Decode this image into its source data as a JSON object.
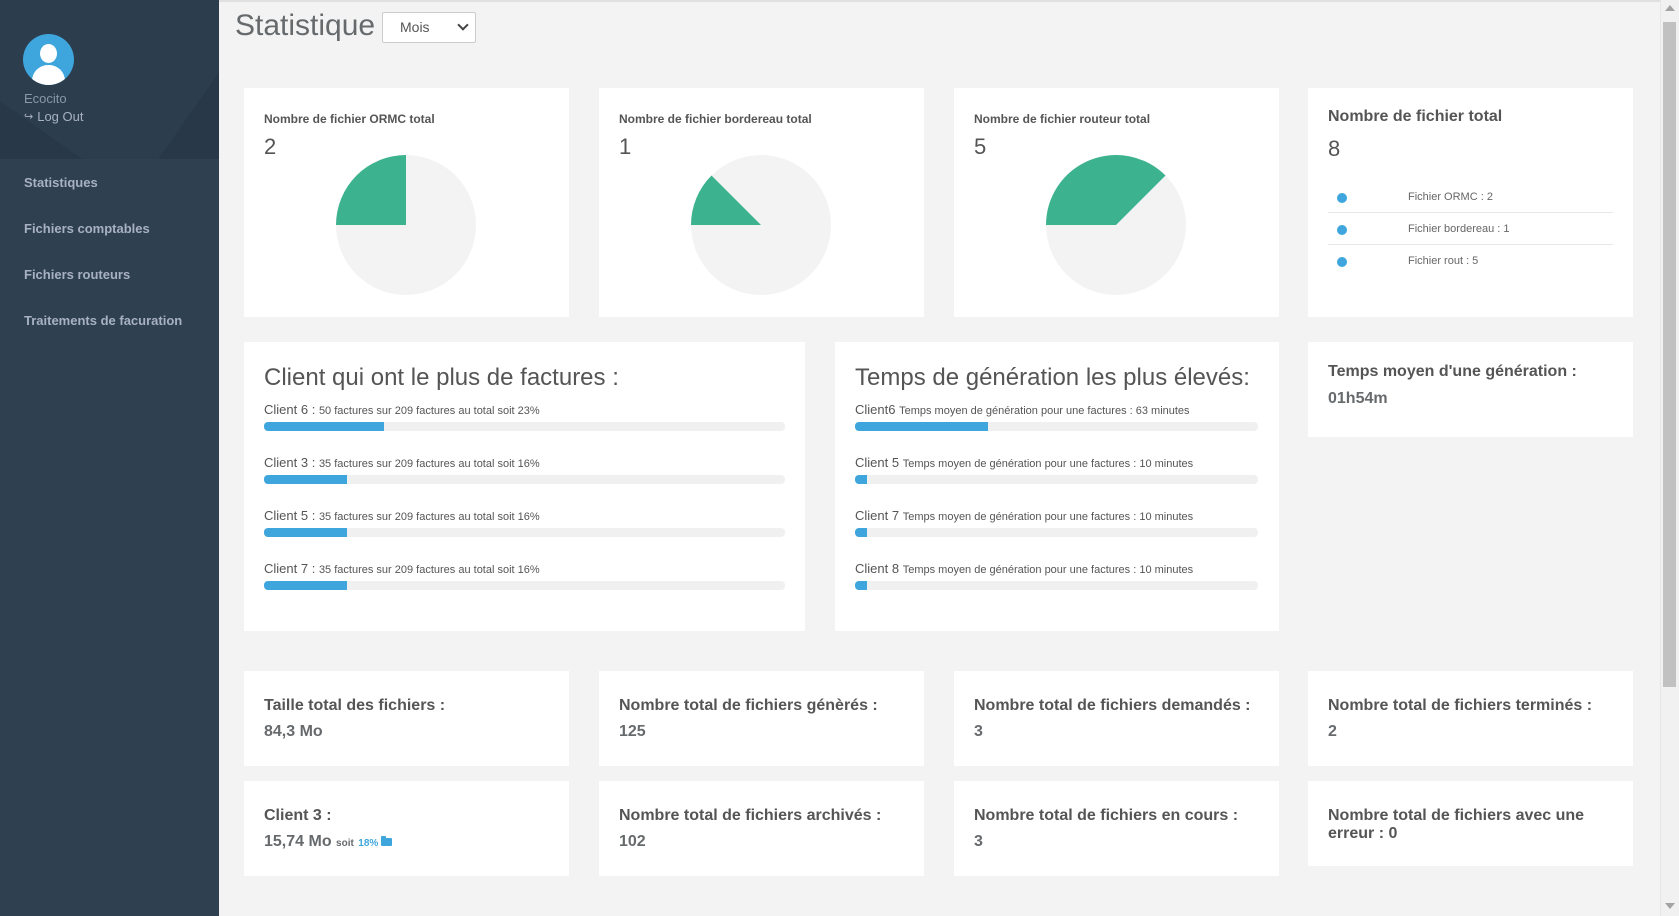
{
  "sidebar": {
    "username": "Ecocito",
    "logout": "Log Out",
    "items": [
      {
        "label": "Statistiques"
      },
      {
        "label": "Fichiers comptables"
      },
      {
        "label": "Fichiers routeurs"
      },
      {
        "label": "Traitements de facuration"
      }
    ]
  },
  "header": {
    "title": "Statistique",
    "period": "Mois"
  },
  "pies": [
    {
      "title": "Nombre de fichier ORMC total",
      "value": "2",
      "fraction": 0.25
    },
    {
      "title": "Nombre de fichier bordereau total",
      "value": "1",
      "fraction": 0.125
    },
    {
      "title": "Nombre de fichier routeur total",
      "value": "5",
      "fraction": 0.375
    }
  ],
  "total": {
    "title": "Nombre de fichier total",
    "value": "8",
    "items": [
      "Fichier ORMC : 2",
      "Fichier bordereau : 1",
      "Fichier rout : 5"
    ]
  },
  "clients": {
    "title": "Client qui ont le plus de factures :",
    "rows": [
      {
        "name": "Client 6 :",
        "desc": "50 factures sur 209 factures au total soit 23%",
        "percent": 23
      },
      {
        "name": "Client 3 :",
        "desc": "35 factures sur 209 factures au total soit 16%",
        "percent": 16
      },
      {
        "name": "Client 5 :",
        "desc": "35 factures sur 209 factures au total soit 16%",
        "percent": 16
      },
      {
        "name": "Client 7 :",
        "desc": "35 factures sur 209 factures au total soit 16%",
        "percent": 16
      }
    ]
  },
  "generation": {
    "title": "Temps de génération les plus élevés:",
    "rows": [
      {
        "name": "Client6",
        "desc": "Temps moyen de génération pour une factures : 63 minutes",
        "percent": 33
      },
      {
        "name": "Client 5",
        "desc": "Temps moyen de génération pour une factures : 10 minutes",
        "percent": 3
      },
      {
        "name": "Client 7",
        "desc": "Temps moyen de génération pour une factures : 10 minutes",
        "percent": 3
      },
      {
        "name": "Client 8",
        "desc": "Temps moyen de génération pour une factures : 10 minutes",
        "percent": 3
      }
    ]
  },
  "avg": {
    "title": "Temps moyen d'une génération :",
    "value": "01h54m"
  },
  "stats": [
    {
      "title": "Taille total des fichiers :",
      "value": "84,3 Mo"
    },
    {
      "title": "Nombre total de fichiers génèrés :",
      "value": "125"
    },
    {
      "title": "Nombre total de fichiers demandés :",
      "value": "3"
    },
    {
      "title": "Nombre total de fichiers terminés :",
      "value": "2"
    },
    {
      "title": "Client 3 :",
      "value": "15,74 Mo",
      "soit": "soit",
      "pct": "18%"
    },
    {
      "title": "Nombre total de fichiers archivés :",
      "value": "102"
    },
    {
      "title": "Nombre total de fichiers en cours :",
      "value": "3"
    },
    {
      "title": "Nombre total de fichiers avec une",
      "title2": "erreur : 0"
    }
  ],
  "colors": {
    "sidebar": "#2f4050",
    "accent": "#3ea6dc",
    "pie": "#3cb38e",
    "pie_bg": "#f3f3f3"
  }
}
